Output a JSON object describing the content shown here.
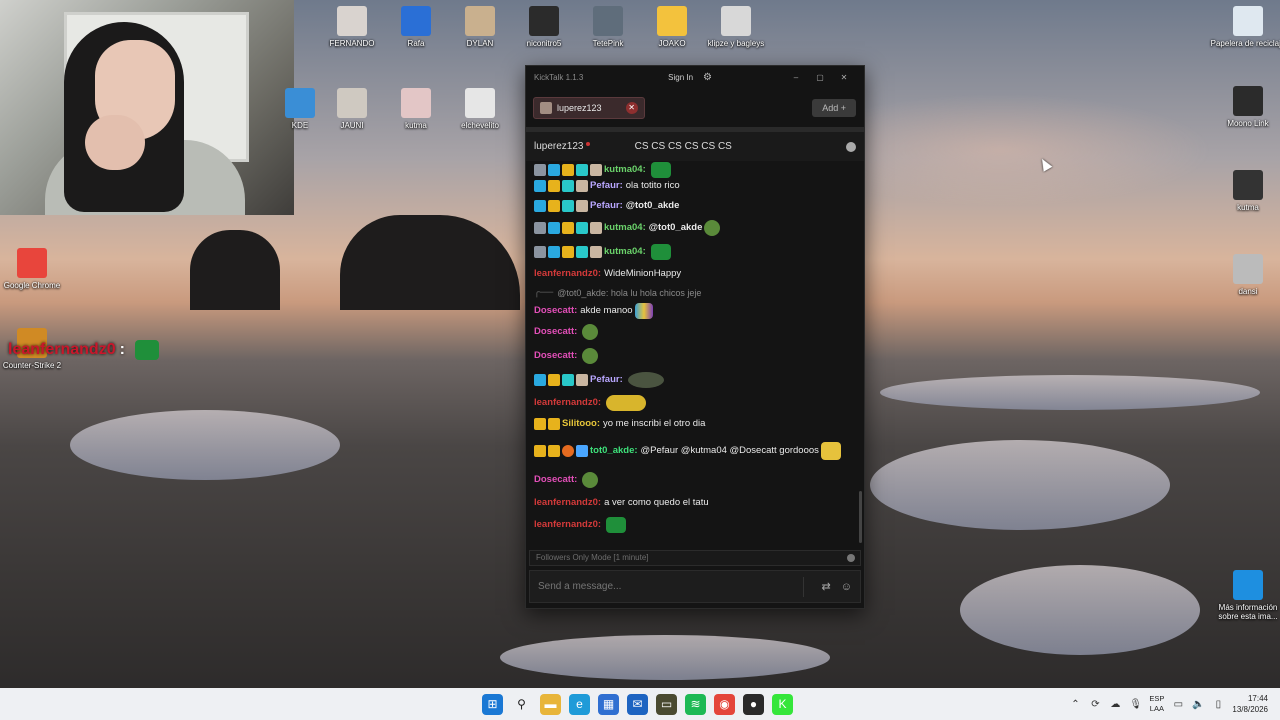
{
  "desktop": {
    "icons_top": [
      {
        "label": "FERNANDO",
        "color": "#d9d3cf"
      },
      {
        "label": "Rafa",
        "color": "#2a6fd6"
      },
      {
        "label": "DYLAN",
        "color": "#c9b08e"
      },
      {
        "label": "niconitro5",
        "color": "#2b2b2b"
      },
      {
        "label": "TetePink",
        "color": "#5f6d7b"
      },
      {
        "label": "JOAKO",
        "color": "#f3c23d"
      },
      {
        "label": "klipze y bagleys",
        "color": "#d8d8d8"
      }
    ],
    "icons_row2": [
      {
        "label": "KDE",
        "color": "#3a8ed6"
      },
      {
        "label": "JAUNI",
        "color": "#cfc9c1"
      },
      {
        "label": "kutma",
        "color": "#e3c6c6"
      },
      {
        "label": "elchevelito",
        "color": "#e6e6e6"
      }
    ],
    "icons_left": [
      {
        "label": "Google Chrome",
        "color": "#e8453c"
      },
      {
        "label": "Counter-Strike 2",
        "color": "#d08a24"
      }
    ],
    "icons_right": [
      {
        "label": "Papelera de reciclaje",
        "color": "#dfe8f0"
      },
      {
        "label": "Moono Link",
        "color": "#2b2b2b"
      },
      {
        "label": "kutma",
        "color": "#333333"
      },
      {
        "label": "dansi",
        "color": "#bbbbbb"
      },
      {
        "label": "Más información sobre esta ima...",
        "color": "#1e8fe0"
      }
    ],
    "overlay": {
      "username": "leanfernandz0",
      "colon": ":"
    }
  },
  "kicktalk": {
    "app_title": "KickTalk 1.1.3",
    "signin_label": "Sign In",
    "gear_icon": "gear-icon",
    "minimize": "–",
    "maximize": "▢",
    "close": "✕",
    "tab": {
      "label": "luperez123",
      "close": "✕"
    },
    "add_label": "Add +",
    "channel": {
      "name": "luperez123",
      "stream_title": "CS CS CS CS CS CS"
    },
    "messages": [
      {
        "user": "kutma04",
        "color": "#6bd36b",
        "badges": [
          "grey",
          "blue",
          "gold",
          "cyan",
          "face"
        ],
        "text": "",
        "emotes": [
          "green"
        ],
        "cut": true
      },
      {
        "user": "Pefaur",
        "color": "#b9a7ff",
        "badges": [
          "blue",
          "gold",
          "cyan",
          "face"
        ],
        "text": "ola totito rico",
        "emotes": []
      },
      {
        "user": "Pefaur",
        "color": "#b9a7ff",
        "badges": [
          "blue",
          "gold",
          "cyan",
          "face"
        ],
        "text": "@tot0_akde",
        "emotes": [],
        "bold_text": true
      },
      {
        "user": "kutma04",
        "color": "#6bd36b",
        "badges": [
          "grey",
          "blue",
          "gold",
          "cyan",
          "face"
        ],
        "text": "@tot0_akde",
        "emotes": [
          "pepe"
        ],
        "bold_text": true
      },
      {
        "user": "kutma04",
        "color": "#6bd36b",
        "badges": [
          "grey",
          "blue",
          "gold",
          "cyan",
          "face"
        ],
        "text": "",
        "emotes": [
          "green"
        ]
      },
      {
        "user": "leanfernandz0",
        "color": "#d43a3a",
        "badges": [],
        "text": "WideMinionHappy",
        "emotes": []
      },
      {
        "reply": true,
        "text": "@tot0_akde: hola lu hola chicos jeje"
      },
      {
        "user": "Dosecatt",
        "color": "#e24fb8",
        "badges": [],
        "text": "akde manoo",
        "emotes": [
          "multi"
        ]
      },
      {
        "user": "Dosecatt",
        "color": "#e24fb8",
        "badges": [],
        "text": "",
        "emotes": [
          "pepe"
        ]
      },
      {
        "user": "Dosecatt",
        "color": "#e24fb8",
        "badges": [],
        "text": "",
        "emotes": [
          "pepe"
        ]
      },
      {
        "user": "Pefaur",
        "color": "#b9a7ff",
        "badges": [
          "blue",
          "gold",
          "cyan",
          "face"
        ],
        "text": "",
        "emotes": [
          "dark"
        ]
      },
      {
        "user": "leanfernandz0",
        "color": "#d43a3a",
        "badges": [],
        "text": "",
        "emotes": [
          "min"
        ]
      },
      {
        "user": "Silitooo",
        "color": "#e7c63a",
        "badges": [
          "gold",
          "gold"
        ],
        "text": "yo me inscribi el otro dia",
        "emotes": []
      },
      {
        "user": "tot0_akde",
        "color": "#3ee07a",
        "badges": [
          "gold",
          "gold",
          "orange",
          "ice"
        ],
        "text": "@Pefaur @kutma04 @Dosecatt gordooos",
        "emotes": [
          "hand"
        ]
      },
      {
        "user": "Dosecatt",
        "color": "#e24fb8",
        "badges": [],
        "text": "",
        "emotes": [
          "pepe"
        ]
      },
      {
        "user": "leanfernandz0",
        "color": "#d43a3a",
        "badges": [],
        "text": "a ver como quedo el tatu",
        "emotes": []
      },
      {
        "user": "leanfernandz0",
        "color": "#d43a3a",
        "badges": [],
        "text": "",
        "emotes": [
          "green"
        ]
      }
    ],
    "mode_text": "Followers Only Mode [1 minute]",
    "input_placeholder": "Send a message..."
  },
  "taskbar": {
    "icons": [
      {
        "name": "windows-start-icon",
        "color": "#1a78d4",
        "glyph": "⊞"
      },
      {
        "name": "search-icon",
        "color": "#eef0f3",
        "glyph": "⚲"
      },
      {
        "name": "file-explorer-icon",
        "color": "#e8b53a",
        "glyph": "▬"
      },
      {
        "name": "edge-icon",
        "color": "#1f9bd8",
        "glyph": "e"
      },
      {
        "name": "store-icon",
        "color": "#2f6fd1",
        "glyph": "▦"
      },
      {
        "name": "outlook-icon",
        "color": "#1d64c1",
        "glyph": "✉"
      },
      {
        "name": "game-icon",
        "color": "#4a4a30",
        "glyph": "▭"
      },
      {
        "name": "spotify-icon",
        "color": "#1db954",
        "glyph": "≋"
      },
      {
        "name": "chrome-icon",
        "color": "#e4453a",
        "glyph": "◉"
      },
      {
        "name": "obs-icon",
        "color": "#2a2a2a",
        "glyph": "●"
      },
      {
        "name": "kick-icon",
        "color": "#35e63a",
        "glyph": "K"
      }
    ],
    "lang_line1": "ESP",
    "lang_line2": "LAA",
    "time": "17:44",
    "date": "13/8/2026"
  }
}
